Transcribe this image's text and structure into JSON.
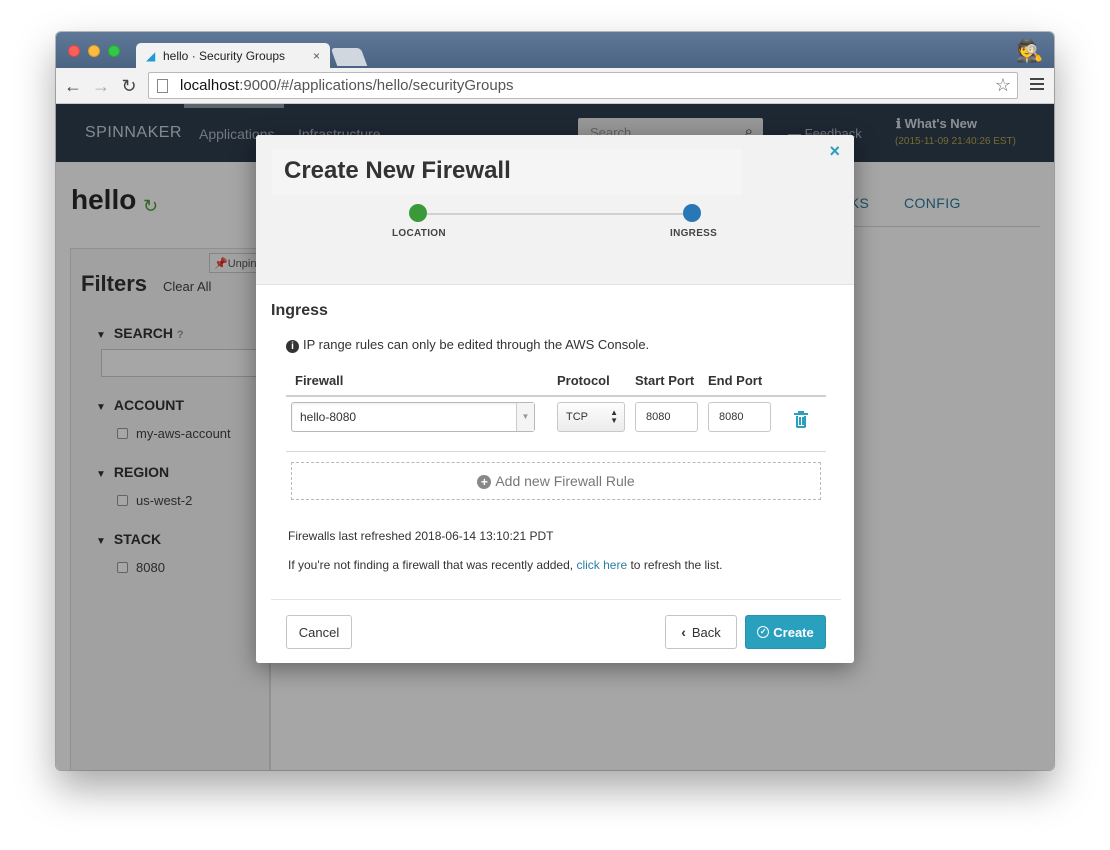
{
  "browser": {
    "tab_title": "hello · Security Groups",
    "tab_close": "×",
    "url_host": "localhost",
    "url_path": ":9000/#/applications/hello/securityGroups"
  },
  "nav": {
    "brand": "SPINNAKER",
    "links": [
      "Applications",
      "Infrastructure"
    ],
    "search_placeholder": "Search",
    "feedback": "Feedback",
    "whats_new": "What's New",
    "whats_new_date": "(2015-11-09 21:40:26 EST)"
  },
  "app": {
    "title": "hello",
    "right_tabs": [
      "SKS",
      "CONFIG"
    ]
  },
  "filters": {
    "title": "Filters",
    "clear_all": "Clear All",
    "unpin": "Unpin",
    "sections": [
      {
        "name": "SEARCH",
        "items": []
      },
      {
        "name": "ACCOUNT",
        "items": [
          "my-aws-account"
        ]
      },
      {
        "name": "REGION",
        "items": [
          "us-west-2"
        ]
      },
      {
        "name": "STACK",
        "items": [
          "8080"
        ]
      }
    ]
  },
  "modal": {
    "title": "Create New Firewall",
    "close": "×",
    "steps": [
      {
        "label": "LOCATION",
        "status": "complete",
        "color": "#3a9a3a"
      },
      {
        "label": "INGRESS",
        "status": "current",
        "color": "#2a77b8"
      }
    ],
    "section_title": "Ingress",
    "info_note": "IP range rules can only be edited through the AWS Console.",
    "columns": [
      "Firewall",
      "Protocol",
      "Start Port",
      "End Port"
    ],
    "rule": {
      "firewall": "hello-8080",
      "protocol": "TCP",
      "start_port": "8080",
      "end_port": "8080"
    },
    "add_rule": "Add new Firewall Rule",
    "refreshed": "Firewalls last refreshed 2018-06-14 13:10:21 PDT",
    "refresh_note_before": "If you're not finding a firewall that was recently added, ",
    "refresh_link": "click here",
    "refresh_note_after": " to refresh the list.",
    "buttons": {
      "cancel": "Cancel",
      "back": "Back",
      "create": "Create"
    }
  },
  "colors": {
    "accent": "#2aa0bf",
    "nav_bg": "#2e3e4f",
    "link": "#2a7fa6"
  }
}
